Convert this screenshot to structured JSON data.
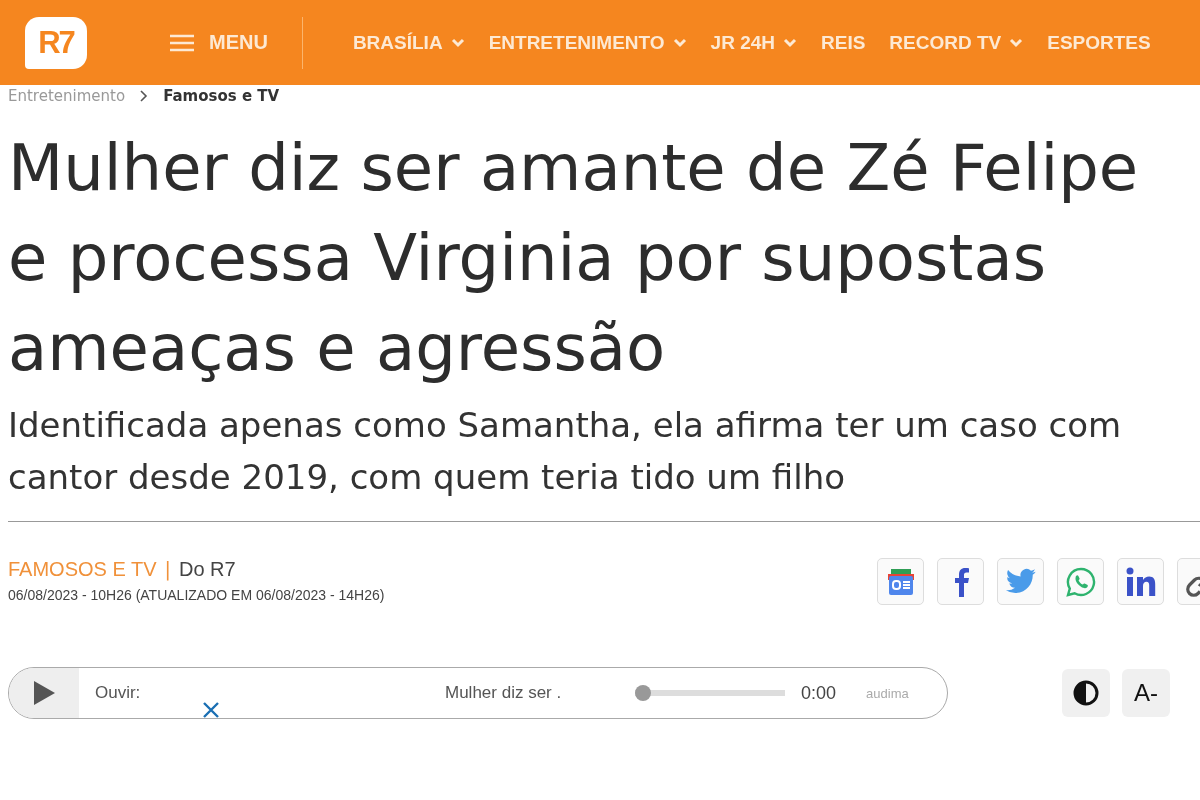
{
  "header": {
    "logo": "R7",
    "menu": "MENU",
    "nav": [
      {
        "label": "BRASÍLIA",
        "dropdown": true
      },
      {
        "label": "ENTRETENIMENTO",
        "dropdown": true
      },
      {
        "label": "JR 24H",
        "dropdown": true
      },
      {
        "label": "REIS",
        "dropdown": false
      },
      {
        "label": "RECORD TV",
        "dropdown": true
      },
      {
        "label": "ESPORTES",
        "dropdown": false
      }
    ]
  },
  "breadcrumb": [
    {
      "label": "Entretenimento",
      "current": false
    },
    {
      "label": "Famosos e TV",
      "current": true
    }
  ],
  "headline": [
    "Mulher diz ser amante de Zé Felipe",
    "e processa Virginia por supostas",
    "ameaças e agressão"
  ],
  "subtitle": [
    "Identificada apenas como Samantha, ela afirma ter um caso com",
    "cantor desde 2019, com quem teria tido um filho"
  ],
  "meta": {
    "section": "FAMOSOS E TV",
    "separator": "|",
    "source": "Do R7",
    "date": "06/08/2023 - 10H26 (ATUALIZADO EM 06/08/2023 - 14H26)"
  },
  "share": [
    {
      "kind": "google-news"
    },
    {
      "kind": "facebook"
    },
    {
      "kind": "twitter"
    },
    {
      "kind": "whatsapp"
    },
    {
      "kind": "linkedin"
    },
    {
      "kind": "link"
    }
  ],
  "player": {
    "label": "Ouvir:",
    "title": "Mulher diz ser .",
    "level": 0,
    "time": "0:00",
    "brand": "audima"
  },
  "tools": [
    {
      "kind": "contrast"
    },
    {
      "kind": "text",
      "label": "A-"
    }
  ]
}
